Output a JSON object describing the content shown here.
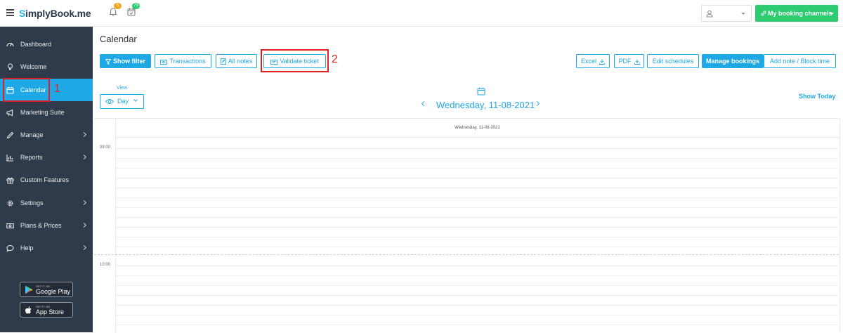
{
  "brand": {
    "logo_s": "S",
    "logo_rest": "implyBook.me"
  },
  "topbar": {
    "notifications_badge": "5",
    "tasks_badge": "79",
    "booking_channels_label": "My booking channels",
    "colors": {
      "accent": "#1ea9e6",
      "green": "#2ecc71",
      "sidebar": "#2f3b4b"
    }
  },
  "sidebar": {
    "items": [
      {
        "label": "Dashboard",
        "icon": "dashboard-icon",
        "has_arrow": false
      },
      {
        "label": "Welcome",
        "icon": "lightbulb-icon",
        "has_arrow": false
      },
      {
        "label": "Calendar",
        "icon": "calendar-icon",
        "has_arrow": false,
        "active": true
      },
      {
        "label": "Marketing Suite",
        "icon": "megaphone-icon",
        "has_arrow": false
      },
      {
        "label": "Manage",
        "icon": "pencil-icon",
        "has_arrow": true
      },
      {
        "label": "Reports",
        "icon": "bar-chart-icon",
        "has_arrow": true
      },
      {
        "label": "Custom Features",
        "icon": "gift-icon",
        "has_arrow": false
      },
      {
        "label": "Settings",
        "icon": "gear-icon",
        "has_arrow": true
      },
      {
        "label": "Plans & Prices",
        "icon": "money-icon",
        "has_arrow": true
      },
      {
        "label": "Help",
        "icon": "chat-icon",
        "has_arrow": true
      }
    ],
    "google_play": {
      "small": "GET IT ON",
      "big": "Google Play"
    },
    "app_store": {
      "small": "GET IT ON",
      "big": "App Store"
    }
  },
  "main": {
    "title": "Calendar",
    "toolbar": {
      "show_filter": "Show filter",
      "transactions": "Transactions",
      "all_notes": "All notes",
      "validate_ticket": "Validate ticket",
      "excel": "Excel",
      "pdf": "PDF",
      "edit_schedules": "Edit schedules",
      "manage_bookings": "Manage bookings",
      "add_note": "Add note / Block time"
    },
    "annotations": {
      "step1": "1",
      "step2": "2"
    },
    "view": {
      "label": "View",
      "value": "Day"
    },
    "date_nav": {
      "current_date": "Wednesday, 11-08-2021",
      "show_today": "Show Today"
    },
    "grid": {
      "column_header": "Wednesday, 11-08-2021",
      "times": [
        "09:00",
        "10:00"
      ]
    }
  }
}
